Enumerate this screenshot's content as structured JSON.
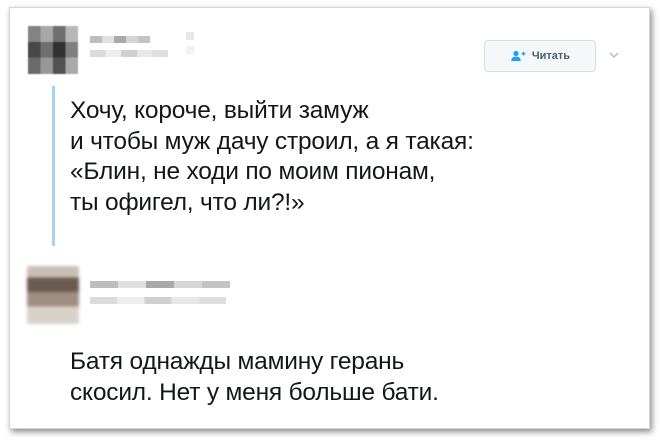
{
  "tweet1": {
    "follow_button": {
      "label": "Читать",
      "icon": "add-user-icon"
    },
    "menu_icon": "chevron-down-icon",
    "lines": [
      "Хочу, короче, выйти замуж",
      "и чтобы муж дачу строил, а я такая:",
      "«Блин, не ходи по моим пионам,",
      "ты офигел, что ли?!»"
    ]
  },
  "tweet2": {
    "lines": [
      "Батя однажды мамину герань",
      "скосил. Нет у меня больше бати."
    ]
  },
  "colors": {
    "thread_line": "#a7d3f0",
    "text": "#14171a",
    "button_text": "#4b5f70",
    "icon_blue": "#1da1f2"
  }
}
